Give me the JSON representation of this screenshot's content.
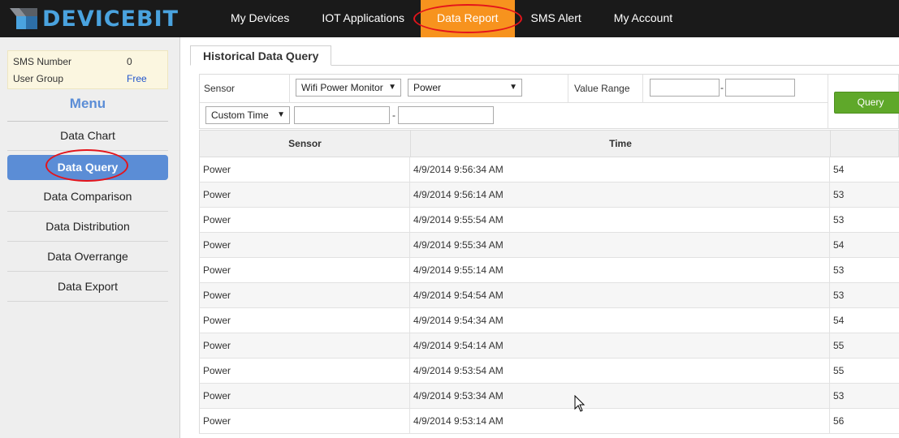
{
  "brand": {
    "name": "DEVICEBIT"
  },
  "nav": {
    "items": [
      {
        "label": "My Devices"
      },
      {
        "label": "IOT Applications"
      },
      {
        "label": "Data Report",
        "active": true
      },
      {
        "label": "SMS Alert"
      },
      {
        "label": "My Account"
      }
    ]
  },
  "sidebar": {
    "info": {
      "sms_label": "SMS Number",
      "sms_value": "0",
      "group_label": "User Group",
      "group_value": "Free"
    },
    "menu_title": "Menu",
    "items": [
      {
        "label": "Data Chart"
      },
      {
        "label": "Data Query",
        "active": true
      },
      {
        "label": "Data Comparison"
      },
      {
        "label": "Data Distribution"
      },
      {
        "label": "Data Overrange"
      },
      {
        "label": "Data Export"
      }
    ]
  },
  "main": {
    "tab": "Historical Data Query",
    "filter": {
      "sensor_label": "Sensor",
      "device_select": "Wifi Power Monitor",
      "sensor_select": "Power",
      "value_range_label": "Value Range",
      "min_value": "",
      "max_value": "",
      "dash": "-",
      "time_select": "Custom Time",
      "start_time": "",
      "end_time": "",
      "query_button": "Query"
    },
    "table": {
      "columns": [
        "Sensor",
        "Time",
        ""
      ],
      "rows": [
        {
          "sensor": "Power",
          "time": "4/9/2014 9:56:34 AM",
          "value": "54"
        },
        {
          "sensor": "Power",
          "time": "4/9/2014 9:56:14 AM",
          "value": "53"
        },
        {
          "sensor": "Power",
          "time": "4/9/2014 9:55:54 AM",
          "value": "53"
        },
        {
          "sensor": "Power",
          "time": "4/9/2014 9:55:34 AM",
          "value": "54"
        },
        {
          "sensor": "Power",
          "time": "4/9/2014 9:55:14 AM",
          "value": "53"
        },
        {
          "sensor": "Power",
          "time": "4/9/2014 9:54:54 AM",
          "value": "53"
        },
        {
          "sensor": "Power",
          "time": "4/9/2014 9:54:34 AM",
          "value": "54"
        },
        {
          "sensor": "Power",
          "time": "4/9/2014 9:54:14 AM",
          "value": "55"
        },
        {
          "sensor": "Power",
          "time": "4/9/2014 9:53:54 AM",
          "value": "55"
        },
        {
          "sensor": "Power",
          "time": "4/9/2014 9:53:34 AM",
          "value": "53"
        },
        {
          "sensor": "Power",
          "time": "4/9/2014 9:53:14 AM",
          "value": "56"
        }
      ]
    }
  },
  "colors": {
    "topbar": "#1a1a1a",
    "nav_active": "#f7931e",
    "highlight_ring": "#e4141b",
    "menu_active": "#5b8dd6",
    "query_button": "#5fa82a",
    "brand": "#4aa3df"
  },
  "icons": {
    "logo": "devicebit-logo-icon",
    "select_arrow": "dropdown-arrow-icon",
    "cursor": "mouse-pointer-icon"
  }
}
